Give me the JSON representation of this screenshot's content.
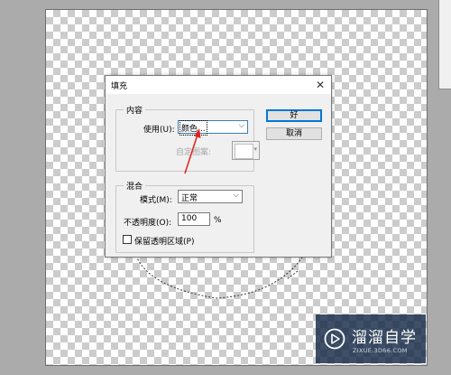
{
  "dialog": {
    "title": "填充",
    "close_glyph": "✕",
    "content_group": {
      "legend": "内容",
      "use_label": "使用(U):",
      "use_value": "颜色...",
      "custom_pattern_label": "自定图案:"
    },
    "blend_group": {
      "legend": "混合",
      "mode_label": "模式(M):",
      "mode_value": "正常",
      "opacity_label": "不透明度(O):",
      "opacity_value": "100",
      "opacity_unit": "%",
      "preserve_transparency_label": "保留透明区域(P)",
      "preserve_transparency_checked": false
    },
    "buttons": {
      "ok_label": "好",
      "cancel_label": "取消"
    }
  },
  "watermark": {
    "title": "溜溜自学",
    "url": "ZIXUE.3D66.COM"
  },
  "colors": {
    "annotation_arrow": "#e02020",
    "workspace_bg": "#ababab",
    "dialog_bg": "#f0f0f0",
    "default_button_border": "#0078d7",
    "watermark_bg": "#142846"
  },
  "icons": {
    "close": "close-icon",
    "dropdown": "chevron-down-icon",
    "logo": "play-logo-icon"
  }
}
